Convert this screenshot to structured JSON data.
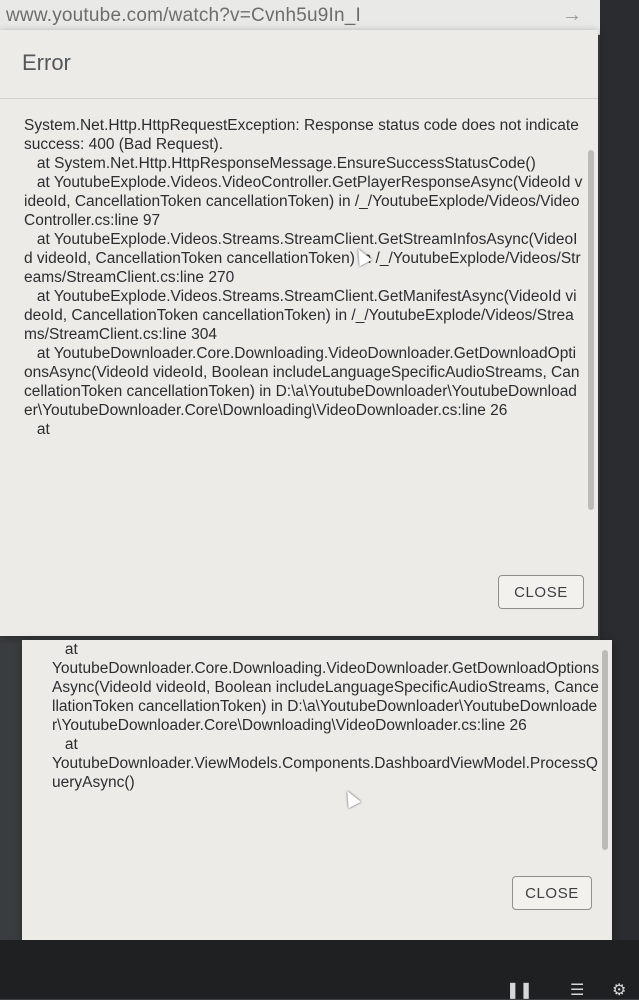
{
  "browser": {
    "url": "www.youtube.com/watch?v=Cvnh5u9In_I"
  },
  "dialogs": [
    {
      "title": "Error",
      "message": "System.Net.Http.HttpRequestException: Response status code does not indicate success: 400 (Bad Request).\n   at System.Net.Http.HttpResponseMessage.EnsureSuccessStatusCode()\n   at YoutubeExplode.Videos.VideoController.GetPlayerResponseAsync(VideoId videoId, CancellationToken cancellationToken) in /_/YoutubeExplode/Videos/VideoController.cs:line 97\n   at YoutubeExplode.Videos.Streams.StreamClient.GetStreamInfosAsync(VideoId videoId, CancellationToken cancellationToken) in /_/YoutubeExplode/Videos/Streams/StreamClient.cs:line 270\n   at YoutubeExplode.Videos.Streams.StreamClient.GetManifestAsync(VideoId videoId, CancellationToken cancellationToken) in /_/YoutubeExplode/Videos/Streams/StreamClient.cs:line 304\n   at YoutubeDownloader.Core.Downloading.VideoDownloader.GetDownloadOptionsAsync(VideoId videoId, Boolean includeLanguageSpecificAudioStreams, CancellationToken cancellationToken) in D:\\a\\YoutubeDownloader\\YoutubeDownloader\\YoutubeDownloader.Core\\Downloading\\VideoDownloader.cs:line 26\n   at",
      "close_label": "CLOSE"
    },
    {
      "message": "   at\nYoutubeDownloader.Core.Downloading.VideoDownloader.GetDownloadOptionsAsync(VideoId videoId, Boolean includeLanguageSpecificAudioStreams, CancellationToken cancellationToken) in D:\\a\\YoutubeDownloader\\YoutubeDownloader\\YoutubeDownloader.Core\\Downloading\\VideoDownloader.cs:line 26\n   at\nYoutubeDownloader.ViewModels.Components.DashboardViewModel.ProcessQueryAsync()",
      "close_label": "CLOSE"
    }
  ],
  "icons": {
    "go": "arrow-right-icon",
    "cursor": "mouse-pointer-icon",
    "taskbar": [
      "pause-icon",
      "menu-icon",
      "gear-icon"
    ]
  },
  "colors": {
    "dialog_bg": "#ecebe8",
    "text": "#2b2d30",
    "title": "#55585c",
    "button_border": "#8f8e8a",
    "desktop": "#3c3f43"
  }
}
